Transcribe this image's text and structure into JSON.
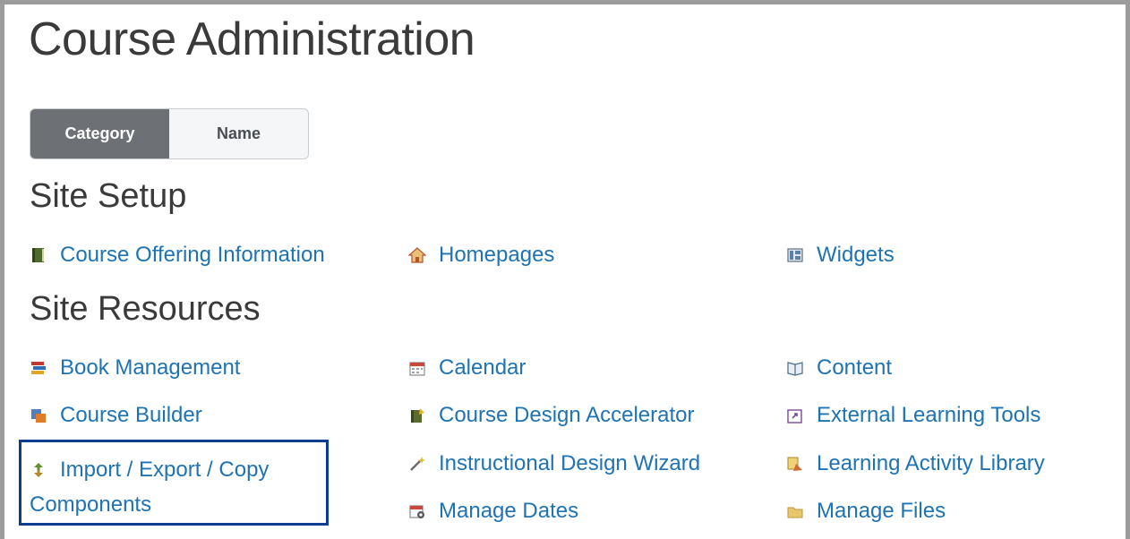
{
  "page": {
    "title": "Course Administration"
  },
  "view_toggle": {
    "category_label": "Category",
    "name_label": "Name",
    "active": "Category"
  },
  "sections": {
    "site_setup": {
      "title": "Site Setup",
      "links": [
        {
          "label": "Course Offering Information",
          "icon": "book-icon"
        },
        {
          "label": "Homepages",
          "icon": "home-icon"
        },
        {
          "label": "Widgets",
          "icon": "widgets-icon"
        }
      ]
    },
    "site_resources": {
      "title": "Site Resources",
      "links": [
        {
          "label": "Book Management",
          "icon": "books-stack-icon"
        },
        {
          "label": "Calendar",
          "icon": "calendar-icon"
        },
        {
          "label": "Content",
          "icon": "open-book-icon"
        },
        {
          "label": "Course Builder",
          "icon": "builder-blocks-icon"
        },
        {
          "label": "Course Design Accelerator",
          "icon": "design-accelerator-icon"
        },
        {
          "label": "External Learning Tools",
          "icon": "external-tools-icon"
        },
        {
          "label": "Import / Export / Copy Components",
          "icon": "import-export-arrows-icon"
        },
        {
          "label": "Instructional Design Wizard",
          "icon": "magic-wand-icon"
        },
        {
          "label": "Learning Activity Library",
          "icon": "activity-library-icon"
        },
        {
          "label": "Manage Dates",
          "icon": "calendar-gear-icon"
        },
        {
          "label": "Manage Files",
          "icon": "folder-icon"
        }
      ]
    }
  },
  "colors": {
    "link": "#1d73b3",
    "heading": "#3a3a3a",
    "highlight_border": "#0b3d91",
    "toggle_active": "#6d7176"
  }
}
